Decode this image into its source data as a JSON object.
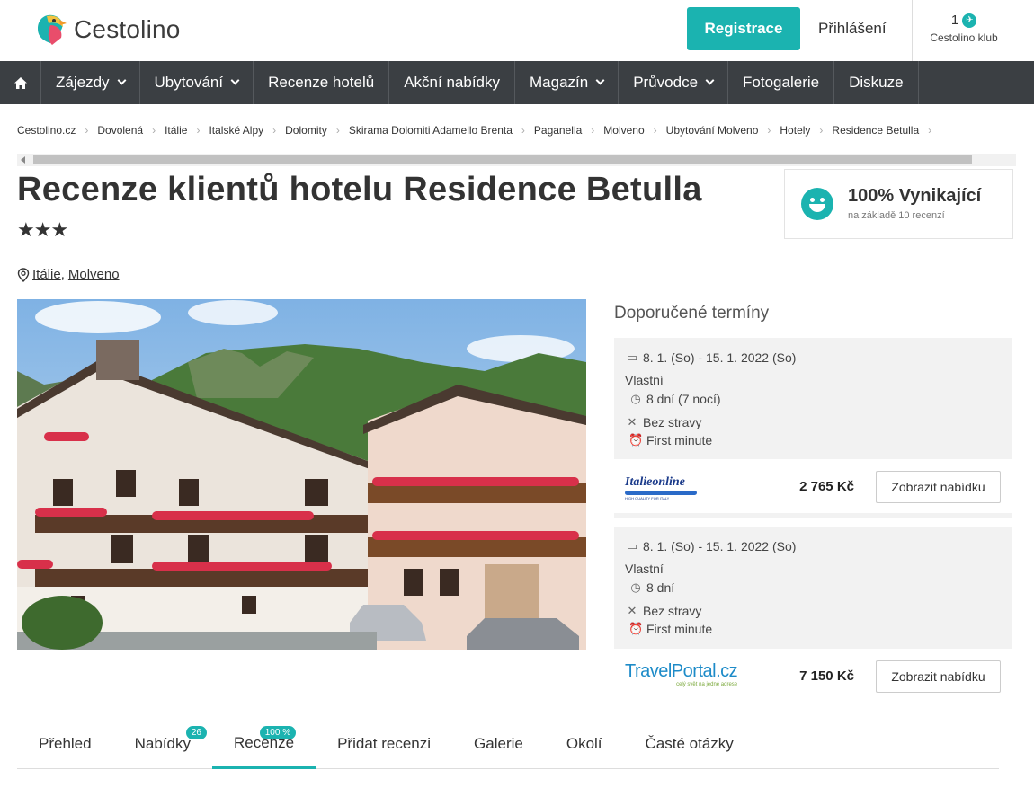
{
  "header": {
    "logo_text": "Cestolino",
    "register_label": "Registrace",
    "login_label": "Přihlášení",
    "club_count": "1",
    "club_label": "Cestolino klub"
  },
  "nav": {
    "items": [
      {
        "label": "Zájezdy",
        "dropdown": true
      },
      {
        "label": "Ubytování",
        "dropdown": true
      },
      {
        "label": "Recenze hotelů",
        "dropdown": false
      },
      {
        "label": "Akční nabídky",
        "dropdown": false
      },
      {
        "label": "Magazín",
        "dropdown": true
      },
      {
        "label": "Průvodce",
        "dropdown": true
      },
      {
        "label": "Fotogalerie",
        "dropdown": false
      },
      {
        "label": "Diskuze",
        "dropdown": false
      }
    ]
  },
  "breadcrumb": [
    "Cestolino.cz",
    "Dovolená",
    "Itálie",
    "Italské Alpy",
    "Dolomity",
    "Skirama Dolomiti Adamello Brenta",
    "Paganella",
    "Molveno",
    "Ubytování Molveno",
    "Hotely",
    "Residence Betulla"
  ],
  "page": {
    "title": "Recenze klientů hotelu Residence Betulla",
    "stars": "★★★",
    "location_country": "Itálie",
    "location_sep": ",",
    "location_city": "Molveno"
  },
  "rating": {
    "value": "100% Vynikající",
    "subtitle": "na základě 10 recenzí"
  },
  "offers": {
    "title": "Doporučené termíny",
    "items": [
      {
        "dates": "8. 1. (So) - 15. 1. 2022 (So)",
        "type": "Vlastní",
        "duration": "8 dní (7 nocí)",
        "board": "Bez stravy",
        "deal": "First minute",
        "agency": "Italieonline",
        "agency_tag": "HIGH QUALITY FOR ITALY",
        "price": "2 765 Kč",
        "button": "Zobrazit nabídku"
      },
      {
        "dates": "8. 1. (So) - 15. 1. 2022 (So)",
        "type": "Vlastní",
        "duration": "8 dní",
        "board": "Bez stravy",
        "deal": "First minute",
        "agency": "TravelPortal.cz",
        "agency_tag": "celý svět na jedné adrese",
        "price": "7 150 Kč",
        "button": "Zobrazit nabídku"
      }
    ]
  },
  "tabs": [
    {
      "label": "Přehled",
      "badge": ""
    },
    {
      "label": "Nabídky",
      "badge": "26"
    },
    {
      "label": "Recenze",
      "badge": "100 %"
    },
    {
      "label": "Přidat recenzi",
      "badge": ""
    },
    {
      "label": "Galerie",
      "badge": ""
    },
    {
      "label": "Okolí",
      "badge": ""
    },
    {
      "label": "Časté otázky",
      "badge": ""
    }
  ],
  "colors": {
    "accent": "#1bb3b0",
    "nav_bg": "#3b3f43"
  }
}
